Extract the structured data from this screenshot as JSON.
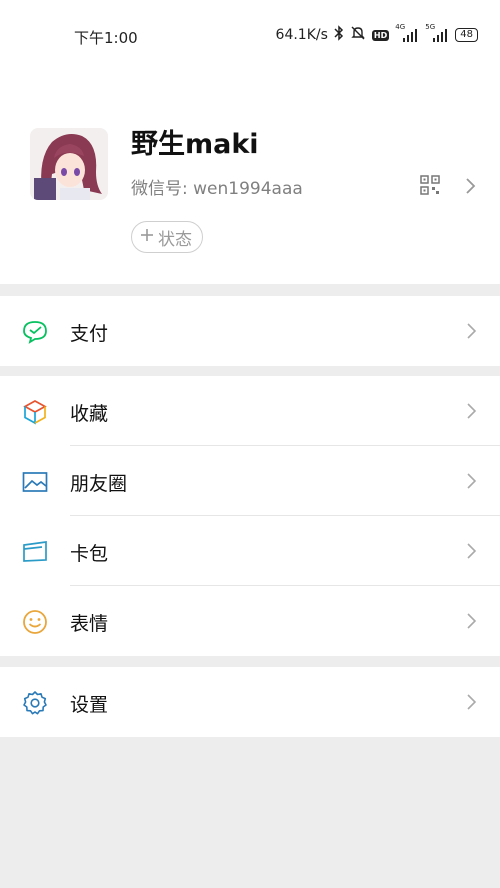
{
  "status_bar": {
    "time": "下午1:00",
    "net_speed": "64.1K/s",
    "hd_badge": "HD",
    "signal1_label": "4G",
    "signal2_label": "5G",
    "battery": "48"
  },
  "profile": {
    "name": "野生maki",
    "wechat_id": "微信号: wen1994aaa",
    "status_button": "状态"
  },
  "menu": {
    "pay": "支付",
    "favorites": "收藏",
    "moments": "朋友圈",
    "cards": "卡包",
    "stickers": "表情",
    "settings": "设置"
  },
  "colors": {
    "accent_green": "#07c160",
    "divider": "#e6e6e6",
    "background": "#ededed"
  }
}
